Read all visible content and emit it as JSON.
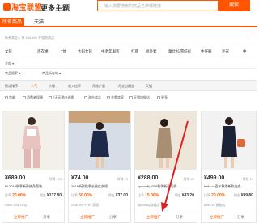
{
  "header": {
    "logo": "淘宝联盟",
    "more": "更多主题",
    "search_placeholder": "输入您要搜索的商品名称或链接",
    "search_button": "搜索"
  },
  "tabs": [
    {
      "label": "所有商品"
    },
    {
      "label": "天猫"
    }
  ],
  "breadcrumb": "所有商品 > 共 526,400 件相关商品",
  "categories": [
    "女装",
    "连衣裙",
    "T恤",
    "大码女装",
    "中老年服装",
    "打底",
    "短外套",
    "蕾丝衫/雪纺衫",
    "牛仔裤",
    "毛衣",
    "中"
  ],
  "filters": {
    "region": "全部 ▾",
    "row2a": "商品搜索 ▾",
    "row2b": "商品所在地 ▾"
  },
  "sortbar": {
    "default": "默认排序",
    "popular": "人气",
    "price": "价格 ▾",
    "commission": "收入比率",
    "sales": "月推广量",
    "rate": "月支出佣金",
    "tmall": "天猫"
  },
  "checks": [
    "包邮",
    "消费者保障",
    "7天无理由退换",
    "海外商品",
    "金牌卖家",
    "天猫旗舰店",
    "更多"
  ],
  "products": [
    {
      "price": "¥689.00",
      "sales": "月销 172",
      "title": "RL2018秋季新款修身西装...",
      "rate_label": "比率",
      "rate": "20.00%",
      "comm_label": "佣金",
      "comm": "¥137.80",
      "shop": "Rose Ling Ling",
      "add": "立即推广",
      "share": "分享"
    },
    {
      "price": "¥74.00",
      "sales": "月销 75",
      "title": "2018新款秋季长袖连衣裙...",
      "rate_label": "比率",
      "rate": "50.00%",
      "comm_label": "佣金",
      "comm": "¥37.00",
      "shop": "ONEREFFON 家居",
      "add": "立即推广",
      "share": "分享"
    },
    {
      "price": "¥288.00",
      "sales": "月销 29",
      "title": "specially2018秋季新款气质...",
      "rate_label": "比率",
      "rate": "15.00%",
      "comm_label": "佣金",
      "comm": "¥43.20",
      "shop": "specially旗舰店",
      "add": "立即推广",
      "share": "分享"
    },
    {
      "price": "¥499.00",
      "sales": "月销 14",
      "title": "bello sz百年秋季新款连衣...",
      "rate_label": "比率",
      "rate": "20.00%",
      "comm_label": "佣金",
      "comm": "¥99.80",
      "shop": "bello sz 旗舰店",
      "add": "立即推广",
      "share": "分享"
    }
  ],
  "colors": {
    "accent": "#ff5500"
  }
}
